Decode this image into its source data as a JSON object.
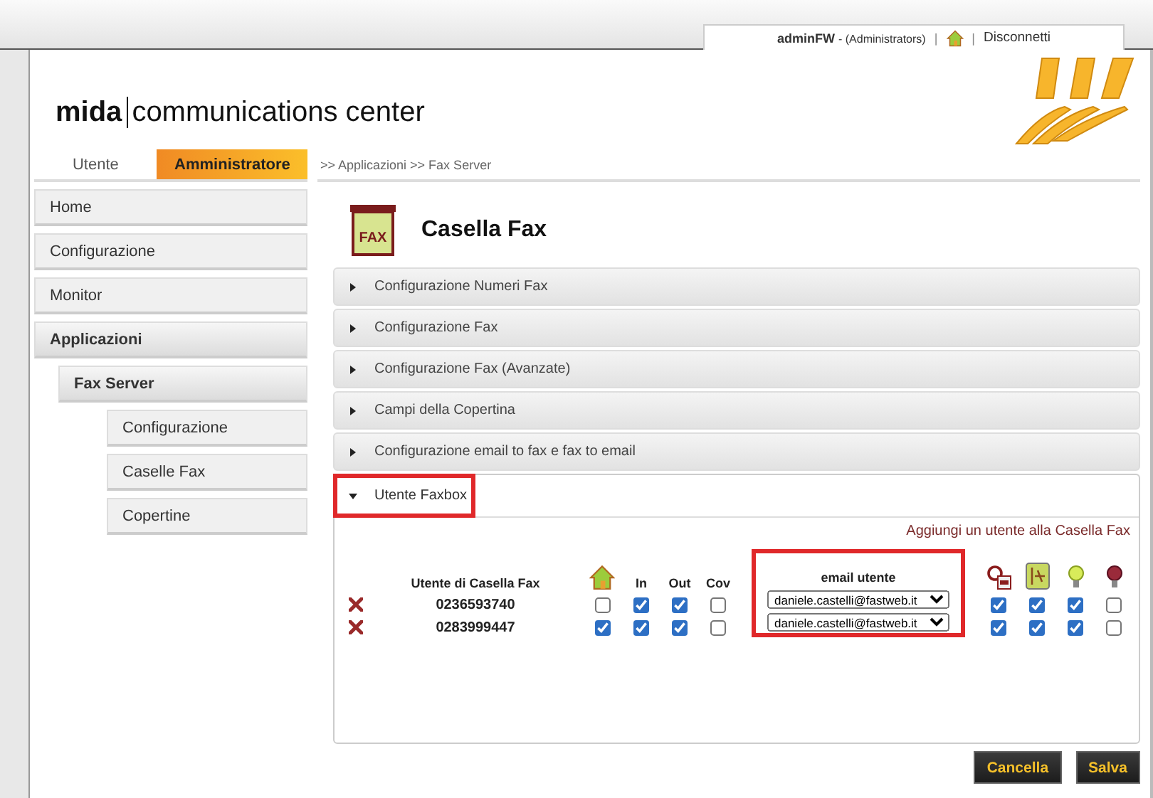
{
  "header": {
    "user": "adminFW",
    "role": "- (Administrators)",
    "separator_1": "|",
    "separator_2": "|",
    "logout": "Disconnetti"
  },
  "logo": {
    "brand": "mida",
    "product": "communications",
    "suffix": "center"
  },
  "mode_tabs": [
    {
      "label": "Utente",
      "selected": false
    },
    {
      "label": "Amministratore",
      "selected": true
    }
  ],
  "breadcrumb": ">> Applicazioni >> Fax Server",
  "sidebar": {
    "items": [
      {
        "label": "Home",
        "selected": false
      },
      {
        "label": "Configurazione",
        "selected": false
      },
      {
        "label": "Monitor",
        "selected": false
      },
      {
        "label": "Applicazioni",
        "selected": true,
        "children": [
          {
            "label": "Fax Server",
            "selected": true,
            "children": [
              {
                "label": "Configurazione",
                "selected": false
              },
              {
                "label": "Caselle Fax",
                "selected": false
              },
              {
                "label": "Copertine",
                "selected": false
              }
            ]
          }
        ]
      }
    ]
  },
  "page_title": "Casella Fax",
  "page_icon_label": "FAX",
  "sections": [
    {
      "label": "Configurazione Numeri Fax",
      "expanded": false,
      "highlighted": false
    },
    {
      "label": "Configurazione Fax",
      "expanded": false,
      "highlighted": false
    },
    {
      "label": "Configurazione Fax (Avanzate)",
      "expanded": false,
      "highlighted": false
    },
    {
      "label": "Campi della Copertina",
      "expanded": false,
      "highlighted": false
    },
    {
      "label": "Configurazione email to fax e fax to email",
      "expanded": false,
      "highlighted": false
    },
    {
      "label": "Utente Faxbox",
      "expanded": true,
      "highlighted": true
    }
  ],
  "add_user_link": "Aggiungi un utente alla Casella Fax",
  "users_table": {
    "number_header": "Utente di Casella Fax",
    "check_columns": [
      {
        "kind": "home"
      },
      {
        "kind": "text",
        "label": "In"
      },
      {
        "kind": "text",
        "label": "Out"
      },
      {
        "kind": "text",
        "label": "Cov"
      }
    ],
    "email_header": "email utente",
    "email_highlighted": true,
    "icon_columns": [
      {
        "kind": "mail-fax"
      },
      {
        "kind": "fax-doc"
      },
      {
        "kind": "bulb-on"
      },
      {
        "kind": "bulb-off"
      }
    ],
    "rows": [
      {
        "number": "0236593740",
        "checks": [
          false,
          true,
          true,
          false
        ],
        "email": "daniele.castelli@fastweb.it",
        "options": [
          true,
          true,
          true,
          false
        ]
      },
      {
        "number": "0283999447",
        "checks": [
          true,
          true,
          true,
          false
        ],
        "email": "daniele.castelli@fastweb.it",
        "options": [
          true,
          true,
          true,
          false
        ]
      }
    ]
  },
  "buttons": [
    {
      "label": "Cancella"
    },
    {
      "label": "Salva"
    }
  ]
}
